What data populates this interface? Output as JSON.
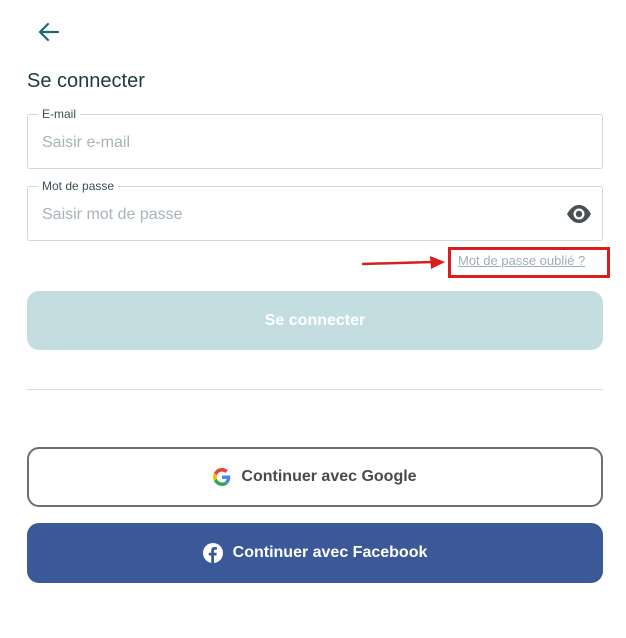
{
  "header": {
    "back_icon": "arrow-left-icon",
    "title": "Se connecter"
  },
  "form": {
    "email": {
      "label": "E-mail",
      "placeholder": "Saisir e-mail",
      "value": ""
    },
    "password": {
      "label": "Mot de passe",
      "placeholder": "Saisir mot de passe",
      "value": "",
      "toggle_icon": "eye-icon"
    },
    "forgot_label": "Mot de passe oublié ?",
    "submit_label": "Se connecter"
  },
  "social": {
    "google_label": "Continuer avec Google",
    "google_icon": "google-icon",
    "facebook_label": "Continuer avec Facebook",
    "facebook_icon": "facebook-icon"
  },
  "colors": {
    "title": "#1e3a3e",
    "submit_bg": "#c4dde0",
    "facebook_bg": "#3b5998",
    "annotation": "#d61f1f"
  }
}
